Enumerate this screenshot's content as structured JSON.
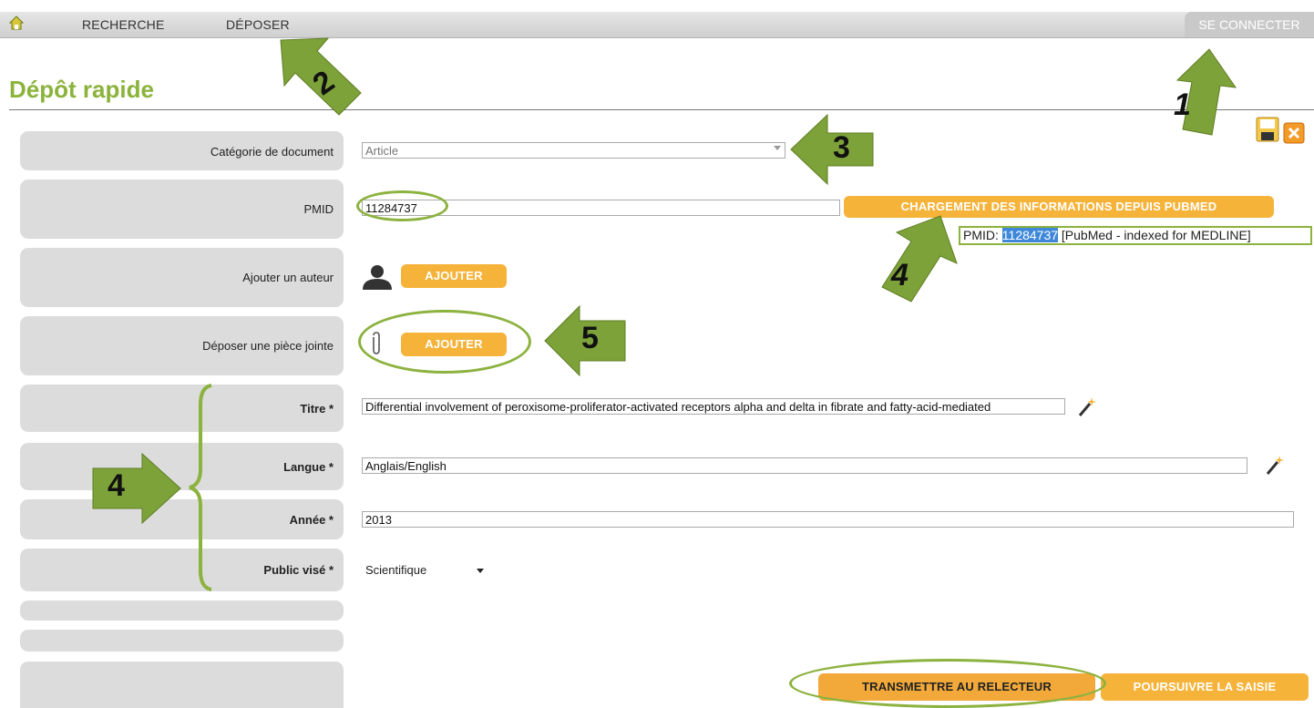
{
  "nav": {
    "items": [
      "RECHERCHE",
      "DÉPOSER"
    ],
    "connect_label": "SE CONNECTER"
  },
  "page": {
    "title": "Dépôt rapide"
  },
  "form": {
    "category": {
      "label": "Catégorie de document",
      "value": "Article"
    },
    "pmid": {
      "label": "PMID",
      "value": "11284737",
      "load_button": "CHARGEMENT DES INFORMATIONS DEPUIS PUBMED",
      "result_prefix": "PMID:",
      "result_id": "11284737",
      "result_suffix": "[PubMed - indexed for MEDLINE]"
    },
    "author": {
      "label": "Ajouter un auteur",
      "button": "AJOUTER"
    },
    "attachment": {
      "label": "Déposer une pièce jointe",
      "button": "AJOUTER"
    },
    "title_field": {
      "label": "Titre *",
      "value": "Differential involvement of peroxisome-proliferator-activated receptors alpha and delta in fibrate and fatty-acid-mediated"
    },
    "language": {
      "label": "Langue *",
      "value": "Anglais/English"
    },
    "year": {
      "label": "Année *",
      "value": "2013"
    },
    "audience": {
      "label": "Public visé *",
      "value": "Scientifique"
    }
  },
  "actions": {
    "transmit": "TRANSMETTRE AU RELECTEUR",
    "continue": "POURSUIVRE LA SAISIE"
  },
  "annotations": [
    "1",
    "2",
    "3",
    "4",
    "4",
    "5"
  ],
  "colors": {
    "accent_green": "#8bb33c",
    "button_orange": "#f6b33a",
    "label_box": "#dcdcdc",
    "highlight": "#3f88d9"
  },
  "icons": [
    "home-icon",
    "user-icon",
    "paperclip-icon",
    "magic-wand-icon",
    "save-icon",
    "close-icon",
    "dropdown-arrow-icon"
  ]
}
